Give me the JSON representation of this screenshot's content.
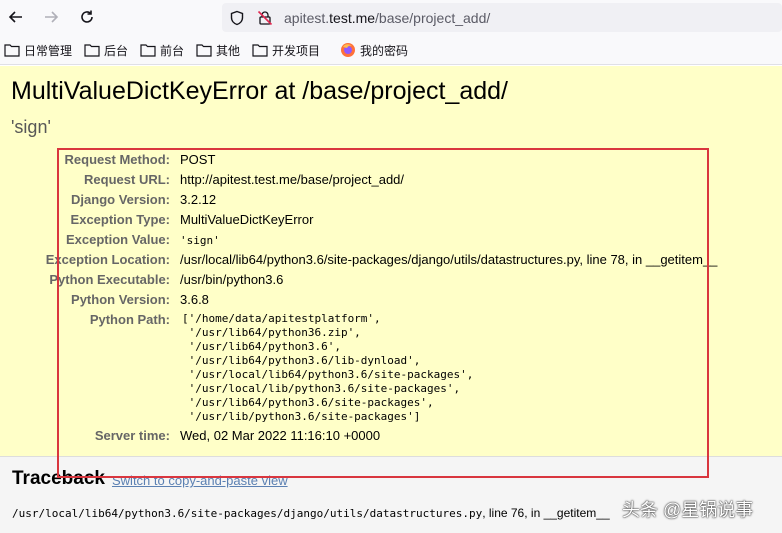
{
  "browser": {
    "url_plain_prefix": "apitest.",
    "url_domain": "test.me",
    "url_path": "/base/project_add/"
  },
  "bookmarks": [
    "日常管理",
    "后台",
    "前台",
    "其他",
    "开发项目",
    "我的密码"
  ],
  "error": {
    "title": "MultiValueDictKeyError at /base/project_add/",
    "subtitle": "'sign'"
  },
  "meta": {
    "request_method": {
      "label": "Request Method:",
      "value": "POST"
    },
    "request_url": {
      "label": "Request URL:",
      "value": "http://apitest.test.me/base/project_add/"
    },
    "django_version": {
      "label": "Django Version:",
      "value": "3.2.12"
    },
    "exception_type": {
      "label": "Exception Type:",
      "value": "MultiValueDictKeyError"
    },
    "exception_value": {
      "label": "Exception Value:",
      "value": "'sign'"
    },
    "exception_location": {
      "label": "Exception Location:",
      "value": "/usr/local/lib64/python3.6/site-packages/django/utils/datastructures.py, line 78, in __getitem__"
    },
    "python_executable": {
      "label": "Python Executable:",
      "value": "/usr/bin/python3.6"
    },
    "python_version": {
      "label": "Python Version:",
      "value": "3.6.8"
    },
    "python_path": {
      "label": "Python Path:",
      "value": "['/home/data/apitestplatform',\n '/usr/lib64/python36.zip',\n '/usr/lib64/python3.6',\n '/usr/lib64/python3.6/lib-dynload',\n '/usr/local/lib64/python3.6/site-packages',\n '/usr/local/lib/python3.6/site-packages',\n '/usr/lib64/python3.6/site-packages',\n '/usr/lib/python3.6/site-packages']"
    },
    "server_time": {
      "label": "Server time:",
      "value": "Wed, 02 Mar 2022 11:16:10 +0000"
    }
  },
  "traceback": {
    "title": "Traceback",
    "switch_link": "Switch to copy-and-paste view",
    "file_path": "/usr/local/lib64/python3.6/site-packages/django/utils/datastructures.py",
    "line_info": ", line 76, in __getitem__"
  },
  "watermark": "头条 @星锅说事",
  "colors": {
    "summary_bg": "#ffffc8",
    "highlight_border": "#d9363e",
    "link": "#5b80b2"
  }
}
